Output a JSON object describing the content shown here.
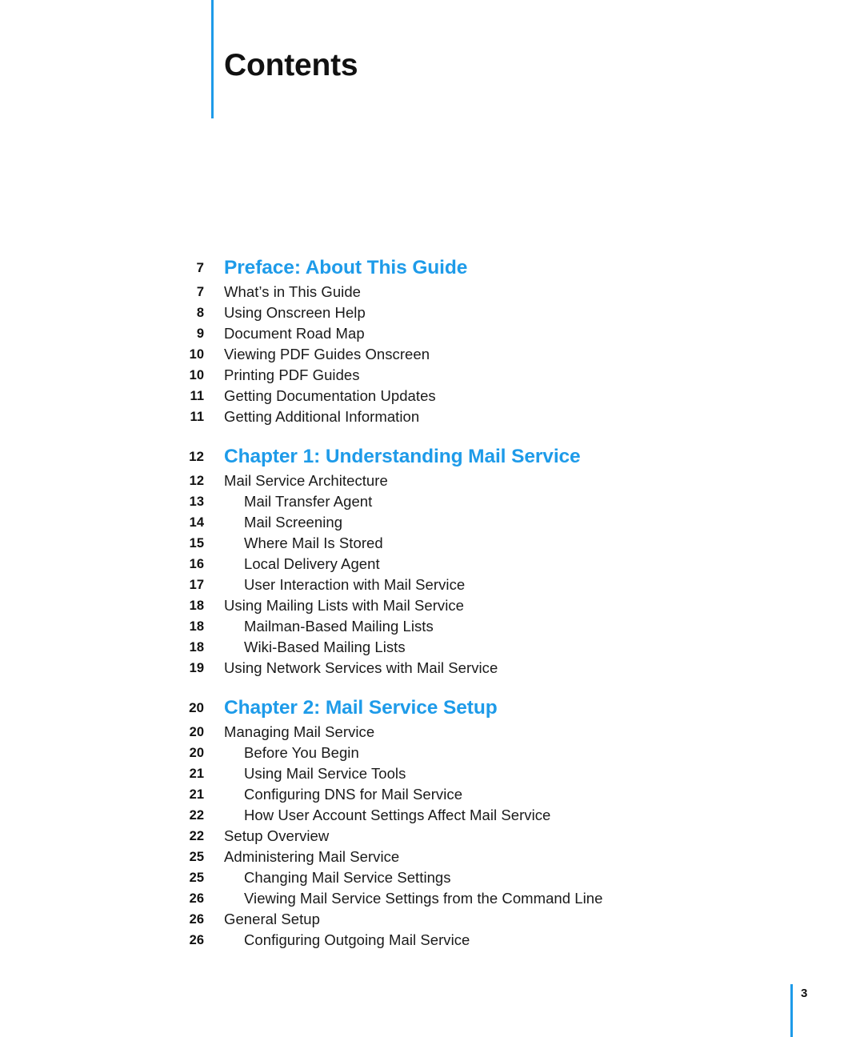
{
  "document": {
    "title": "Contents",
    "folio": "3",
    "accent_color": "#1E9BE9",
    "text_color": "#1a1a1a"
  },
  "toc": {
    "sections": [
      {
        "heading": {
          "page": "7",
          "label": "Preface: About This Guide",
          "level": "heading"
        },
        "entries": [
          {
            "page": "7",
            "label": "What’s in This Guide",
            "level": 1
          },
          {
            "page": "8",
            "label": "Using Onscreen Help",
            "level": 1
          },
          {
            "page": "9",
            "label": "Document Road Map",
            "level": 1
          },
          {
            "page": "10",
            "label": "Viewing PDF Guides Onscreen",
            "level": 1
          },
          {
            "page": "10",
            "label": "Printing PDF Guides",
            "level": 1
          },
          {
            "page": "11",
            "label": "Getting Documentation Updates",
            "level": 1
          },
          {
            "page": "11",
            "label": "Getting Additional Information",
            "level": 1
          }
        ]
      },
      {
        "heading": {
          "page": "12",
          "label": "Chapter 1: Understanding Mail Service",
          "level": "heading"
        },
        "entries": [
          {
            "page": "12",
            "label": "Mail Service Architecture",
            "level": 1
          },
          {
            "page": "13",
            "label": "Mail Transfer Agent",
            "level": 2
          },
          {
            "page": "14",
            "label": "Mail Screening",
            "level": 2
          },
          {
            "page": "15",
            "label": "Where Mail Is Stored",
            "level": 2
          },
          {
            "page": "16",
            "label": "Local Delivery Agent",
            "level": 2
          },
          {
            "page": "17",
            "label": "User Interaction with Mail Service",
            "level": 2
          },
          {
            "page": "18",
            "label": "Using Mailing Lists with Mail Service",
            "level": 1
          },
          {
            "page": "18",
            "label": "Mailman-Based Mailing Lists",
            "level": 2
          },
          {
            "page": "18",
            "label": "Wiki-Based Mailing Lists",
            "level": 2
          },
          {
            "page": "19",
            "label": "Using Network Services with Mail Service",
            "level": 1
          }
        ]
      },
      {
        "heading": {
          "page": "20",
          "label": "Chapter 2: Mail Service Setup",
          "level": "heading"
        },
        "entries": [
          {
            "page": "20",
            "label": "Managing Mail Service",
            "level": 1
          },
          {
            "page": "20",
            "label": "Before You Begin",
            "level": 2
          },
          {
            "page": "21",
            "label": "Using Mail Service Tools",
            "level": 2
          },
          {
            "page": "21",
            "label": "Configuring DNS for Mail Service",
            "level": 2
          },
          {
            "page": "22",
            "label": "How User Account Settings Affect Mail Service",
            "level": 2
          },
          {
            "page": "22",
            "label": "Setup Overview",
            "level": 1
          },
          {
            "page": "25",
            "label": "Administering Mail Service",
            "level": 1
          },
          {
            "page": "25",
            "label": "Changing Mail Service Settings",
            "level": 2
          },
          {
            "page": "26",
            "label": "Viewing Mail Service Settings from the Command Line",
            "level": 2
          },
          {
            "page": "26",
            "label": "General Setup",
            "level": 1
          },
          {
            "page": "26",
            "label": "Configuring Outgoing Mail Service",
            "level": 2
          }
        ]
      }
    ]
  }
}
